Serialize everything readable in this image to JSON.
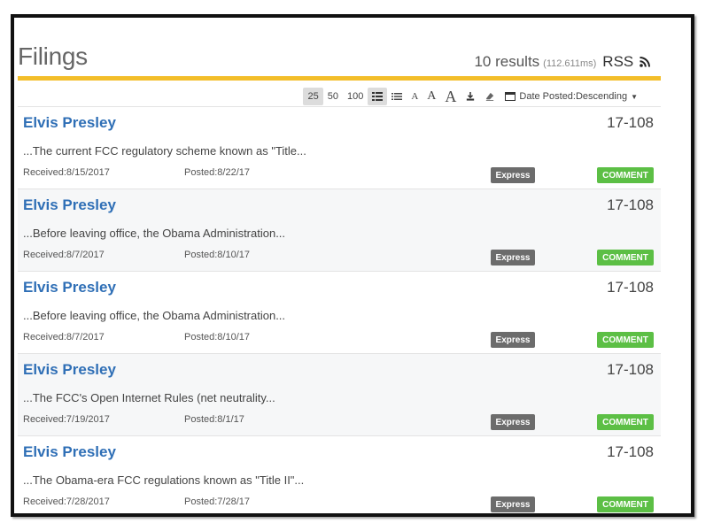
{
  "header": {
    "title": "Filings",
    "results_count": "10 results",
    "results_time": "(112.611ms)",
    "rss_label": "RSS"
  },
  "toolbar": {
    "page_sizes": [
      "25",
      "50",
      "100"
    ],
    "font_size_glyph": "A",
    "sort_label": "Date Posted:Descending"
  },
  "filings": [
    {
      "name": "Elvis Presley",
      "docket": "17-108",
      "snippet": "...The current FCC regulatory scheme known as \"Title...",
      "received": "Received:8/15/2017",
      "posted": "Posted:8/22/17",
      "express": "Express",
      "type": "COMMENT"
    },
    {
      "name": "Elvis Presley",
      "docket": "17-108",
      "snippet": "...Before leaving office, the Obama Administration...",
      "received": "Received:8/7/2017",
      "posted": "Posted:8/10/17",
      "express": "Express",
      "type": "COMMENT"
    },
    {
      "name": "Elvis Presley",
      "docket": "17-108",
      "snippet": "...Before leaving office, the Obama Administration...",
      "received": "Received:8/7/2017",
      "posted": "Posted:8/10/17",
      "express": "Express",
      "type": "COMMENT"
    },
    {
      "name": "Elvis Presley",
      "docket": "17-108",
      "snippet": "...The FCC's Open Internet Rules (net neutrality...",
      "received": "Received:7/19/2017",
      "posted": "Posted:8/1/17",
      "express": "Express",
      "type": "COMMENT"
    },
    {
      "name": "Elvis Presley",
      "docket": "17-108",
      "snippet": "...The Obama-era FCC regulations known as \"Title II\"...",
      "received": "Received:7/28/2017",
      "posted": "Posted:7/28/17",
      "express": "Express",
      "type": "COMMENT"
    }
  ],
  "colors": {
    "accent_gold": "#f3be2a",
    "link_blue": "#2f6fb6",
    "comment_green": "#5cbf45",
    "express_gray": "#6c6c6c"
  }
}
